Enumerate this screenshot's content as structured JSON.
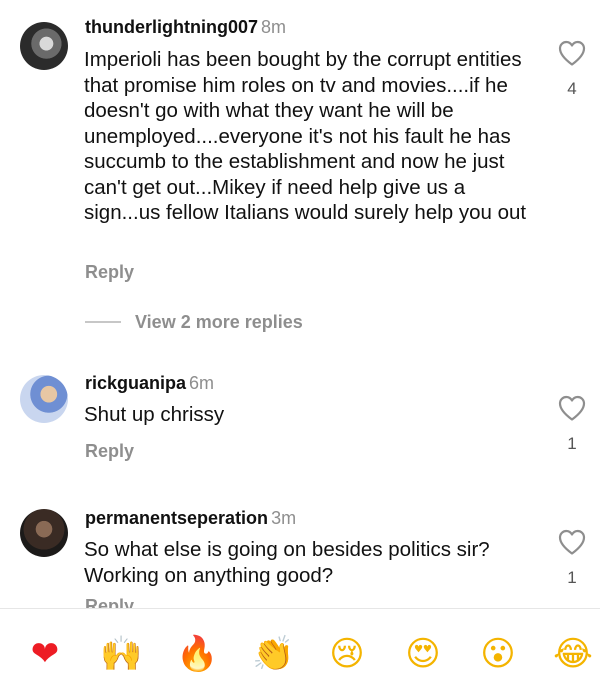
{
  "comments": [
    {
      "username": "thunderlightning007",
      "time": "8m",
      "text": "Imperioli has been bought by the corrupt entities that promise him roles on tv and movies....if he doesn't go with what they want he will be unemployed....everyone it's not his fault he has succumb to the establishment and now he just can't get out...Mikey if need help give us a sign...us fellow Italians would surely help you out",
      "reply_label": "Reply",
      "likes": "4",
      "view_more": "View 2 more replies"
    },
    {
      "username": "rickguanipa",
      "time": "6m",
      "text": "Shut up chrissy",
      "reply_label": "Reply",
      "likes": "1"
    },
    {
      "username": "permanentseperation",
      "time": "3m",
      "text": "So what else is going on besides politics sir? Working on anything good?",
      "reply_label": "Reply",
      "likes": "1"
    }
  ],
  "emoji_bar": [
    {
      "name": "heart",
      "char": "❤"
    },
    {
      "name": "raising-hands",
      "char": "🙌"
    },
    {
      "name": "fire",
      "char": "🔥"
    },
    {
      "name": "clapping-hands",
      "char": "👏"
    },
    {
      "name": "crying-face",
      "char": "😢"
    },
    {
      "name": "heart-eyes",
      "char": "😍"
    },
    {
      "name": "surprised-face",
      "char": "😮"
    },
    {
      "name": "tears-of-joy",
      "char": "😂"
    }
  ],
  "colors": {
    "secondary_text": "#8e8e8e",
    "heart_red": "#ed1c24"
  }
}
